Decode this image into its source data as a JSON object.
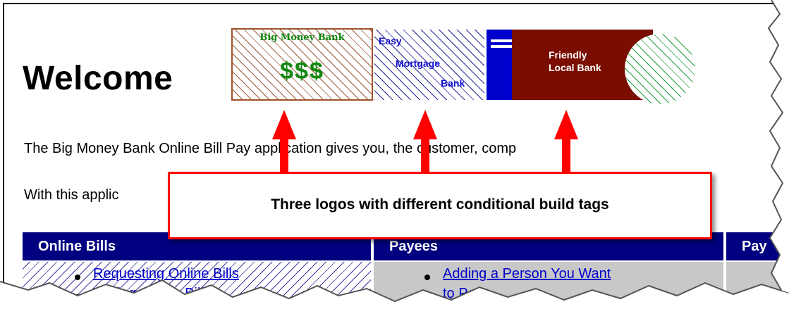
{
  "heading": "Welcome",
  "logos": {
    "big_money_bank": {
      "name": "Big Money Bank",
      "symbol": "$$$"
    },
    "easy_mortgage_bank": {
      "line1": "Easy",
      "line2": "Mortgage",
      "line3": "Bank"
    },
    "friendly_local_bank": {
      "line1": "Friendly",
      "line2": "Local Bank"
    }
  },
  "paragraphs": {
    "intro": "The Big Money Bank Online Bill Pay application gives you, the customer, comp",
    "with_this": "With this applic"
  },
  "callout": {
    "text": "Three logos with different conditional build tags"
  },
  "table": {
    "headers": [
      "Online Bills",
      "Payees",
      "Pay"
    ],
    "col1_links": [
      "Requesting Online Bills",
      "Paying Online Bills"
    ],
    "col2_links": [
      "Adding a Person You Want",
      "to Pay"
    ]
  },
  "colors": {
    "header_bg": "#000080",
    "callout_border": "#ff0000",
    "arrow": "#ff0000",
    "link": "#0000cc",
    "bmb_green": "#118811",
    "flb_red": "#7a0d00",
    "flb_blue": "#0000cc"
  }
}
